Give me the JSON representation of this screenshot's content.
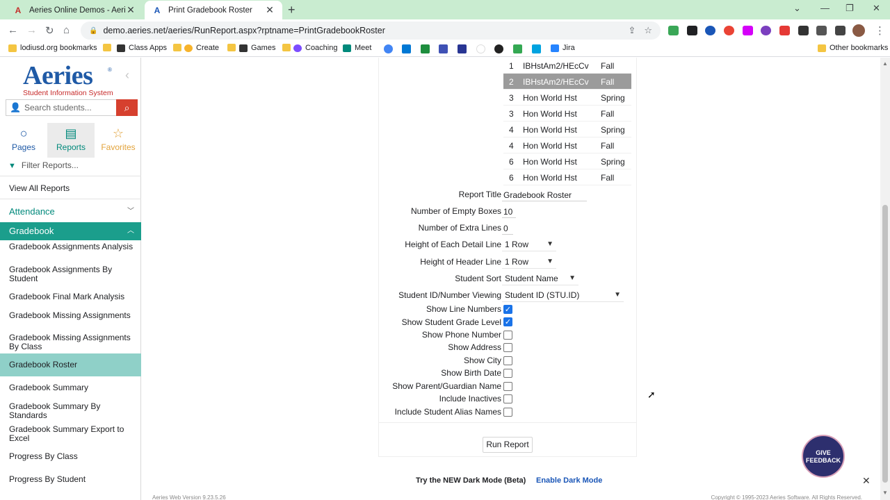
{
  "browser": {
    "tabs": [
      {
        "title": "Aeries Online Demos - Aeries Sof",
        "active": false
      },
      {
        "title": "Print Gradebook Roster",
        "active": true
      }
    ],
    "url": "demo.aeries.net/aeries/RunReport.aspx?rptname=PrintGradebookRoster",
    "bookmarks": [
      "lodiusd.org bookmarks",
      "Class Apps",
      "Create",
      "Games",
      "Coaching",
      "Meet",
      "Jira"
    ],
    "other_bookmarks": "Other bookmarks"
  },
  "sidebar": {
    "logo_word": "Aeries",
    "logo_tm": "®",
    "logo_sub": "Student Information System",
    "search_placeholder": "Search students...",
    "nav": {
      "pages": "Pages",
      "reports": "Reports",
      "favorites": "Favorites"
    },
    "filter_label": "Filter Reports...",
    "view_all": "View All Reports",
    "attendance": "Attendance",
    "gradebook": "Gradebook",
    "items": [
      "Gradebook Assignments Analysis",
      "Gradebook Assignments By Student",
      "Gradebook Final Mark Analysis",
      "Gradebook Missing Assignments",
      "Gradebook Missing Assignments By Class",
      "Gradebook Roster",
      "Gradebook Summary",
      "Gradebook Summary By Standards",
      "Gradebook Summary Export to Excel",
      "Progress By Class",
      "Progress By Student"
    ],
    "selected_item": "Gradebook Roster"
  },
  "gradebooks": [
    {
      "period": "1",
      "course": "IBHstAm2/HEcCv",
      "term": "Fall",
      "selected": false
    },
    {
      "period": "2",
      "course": "IBHstAm2/HEcCv",
      "term": "Fall",
      "selected": true
    },
    {
      "period": "3",
      "course": "Hon World Hst",
      "term": "Spring",
      "selected": false
    },
    {
      "period": "3",
      "course": "Hon World Hst",
      "term": "Fall",
      "selected": false
    },
    {
      "period": "4",
      "course": "Hon World Hst",
      "term": "Spring",
      "selected": false
    },
    {
      "period": "4",
      "course": "Hon World Hst",
      "term": "Fall",
      "selected": false
    },
    {
      "period": "6",
      "course": "Hon World Hst",
      "term": "Spring",
      "selected": false
    },
    {
      "period": "6",
      "course": "Hon World Hst",
      "term": "Fall",
      "selected": false
    }
  ],
  "form": {
    "report_title": {
      "label": "Report Title",
      "value": "Gradebook Roster"
    },
    "empty_boxes": {
      "label": "Number of Empty Boxes",
      "value": "10"
    },
    "extra_lines": {
      "label": "Number of Extra Lines",
      "value": "0"
    },
    "detail_height": {
      "label": "Height of Each Detail Line",
      "value": "1 Row"
    },
    "header_height": {
      "label": "Height of Header Line",
      "value": "1 Row"
    },
    "student_sort": {
      "label": "Student Sort",
      "value": "Student Name"
    },
    "id_viewing": {
      "label": "Student ID/Number Viewing",
      "value": "Student ID (STU.ID)"
    },
    "checkboxes": [
      {
        "label": "Show Line Numbers",
        "checked": true
      },
      {
        "label": "Show Student Grade Level",
        "checked": true
      },
      {
        "label": "Show Phone Number",
        "checked": false
      },
      {
        "label": "Show Address",
        "checked": false
      },
      {
        "label": "Show City",
        "checked": false
      },
      {
        "label": "Show Birth Date",
        "checked": false
      },
      {
        "label": "Show Parent/Guardian Name",
        "checked": false
      },
      {
        "label": "Include Inactives",
        "checked": false
      },
      {
        "label": "Include Student Alias Names",
        "checked": false
      }
    ],
    "run_label": "Run Report"
  },
  "feedback": {
    "line1": "GIVE",
    "line2": "FEEDBACK"
  },
  "darkmode": {
    "prompt": "Try the NEW Dark Mode (Beta)",
    "link": "Enable Dark Mode"
  },
  "footer": {
    "version": "Aeries Web Version 9.23.5.26",
    "copyright": "Copyright © 1995-2023 Aeries Software. All Rights Reserved."
  },
  "colors": {
    "brand_blue": "#1f5aa6",
    "brand_red": "#c62828",
    "teal": "#1b9e8c",
    "selected_teal": "#8fd0c8",
    "search_red": "#d6402e"
  }
}
